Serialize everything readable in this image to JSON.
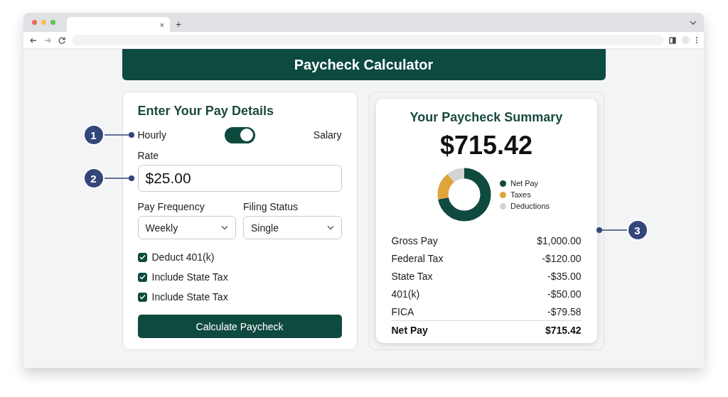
{
  "browser": {
    "tab_close": "×",
    "new_tab": "+"
  },
  "header": {
    "title": "Paycheck Calculator"
  },
  "details": {
    "title": "Enter Your Pay Details",
    "pay_type": {
      "callout": "1",
      "left": "Hourly",
      "right": "Salary",
      "on": true
    },
    "rate": {
      "label": "Rate",
      "callout": "2",
      "value": "$25.00"
    },
    "selects": [
      {
        "label": "Pay Frequency",
        "value": "Weekly"
      },
      {
        "label": "Filing Status",
        "value": "Single"
      }
    ],
    "options": [
      {
        "label": "Deduct 401(k)",
        "checked": true
      },
      {
        "label": "Include State Tax",
        "checked": true
      },
      {
        "label": "Include State Tax",
        "checked": true
      }
    ],
    "button": "Calculate Paycheck"
  },
  "summary": {
    "title": "Your Paycheck Summary",
    "amount": "$715.42",
    "callout": "3",
    "legend": [
      {
        "label": "Net Pay",
        "color": "#0f4a3f"
      },
      {
        "label": "Taxes",
        "color": "#e0a43c"
      },
      {
        "label": "Deductions",
        "color": "#d3d4d4"
      }
    ],
    "rows": [
      {
        "label": "Gross Pay",
        "value": "$1,000.00",
        "kind": "item"
      },
      {
        "label": "Federal Tax",
        "value": "-$120.00",
        "kind": "item"
      },
      {
        "label": "State Tax",
        "value": "-$35.00",
        "kind": "item"
      },
      {
        "label": "401(k)",
        "value": "-$50.00",
        "kind": "item"
      },
      {
        "label": "FICA",
        "value": "-$79.58",
        "kind": "item"
      },
      {
        "label": "Net Pay",
        "value": "$715.42",
        "kind": "total"
      }
    ]
  }
}
